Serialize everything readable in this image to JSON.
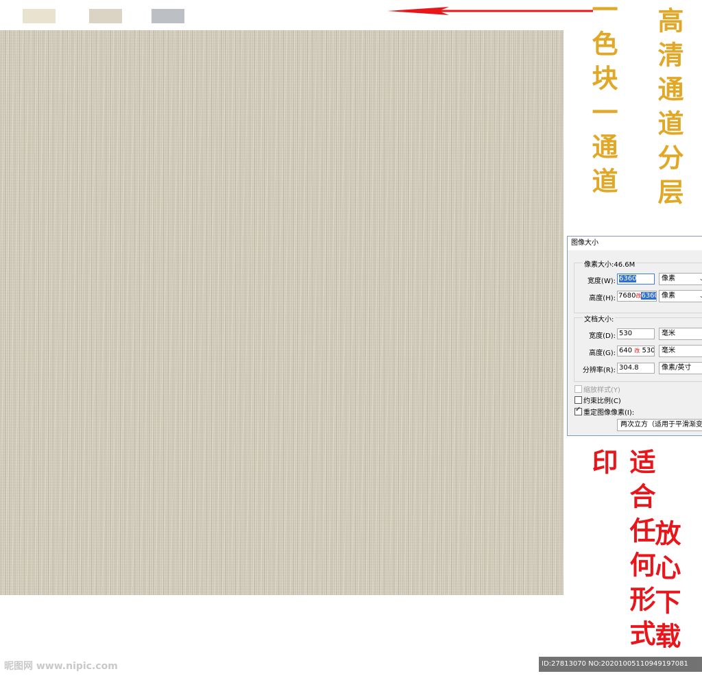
{
  "swatches": [
    {
      "name": "swatch-1",
      "color": "#e9e2cf"
    },
    {
      "name": "swatch-2",
      "color": "#dbd3c3"
    },
    {
      "name": "swatch-3",
      "color": "#bcbfc3"
    }
  ],
  "arrow_color": "#e8161b",
  "annotations": {
    "color_block_channel": "一色块一通道",
    "hd_channel_layers": "高清通道分层",
    "fit_any_print": "适合任何形式印",
    "download_safely": "放心下载"
  },
  "dialog": {
    "title": "图像大小",
    "pixel_dimensions": "像素大小:46.6M",
    "width_label": "宽度(W):",
    "width_value": "6360",
    "width_unit": "像素",
    "height_label": "高度(H):",
    "height_old": "7680",
    "height_mark": "改",
    "height_value": "6360",
    "height_unit": "像素",
    "document_size": "文档大小:",
    "doc_width_label": "宽度(D):",
    "doc_width_value": "530",
    "doc_width_unit": "毫米",
    "doc_height_label": "高度(G):",
    "doc_height_old": "640",
    "doc_height_mark": "改",
    "doc_height_value": "530",
    "doc_height_unit": "毫米",
    "resolution_label": "分辨率(R):",
    "resolution_value": "304.8",
    "resolution_unit": "像素/英寸",
    "scale_styles": "缩放样式(Y)",
    "constrain": "约束比例(C)",
    "resample": "重定图像像素(I):",
    "resample_method": "两次立方（适用于平滑渐变"
  },
  "watermark": "昵图网 www.nipic.com",
  "id_bar": "ID:27813070 NO:20201005110949197081"
}
